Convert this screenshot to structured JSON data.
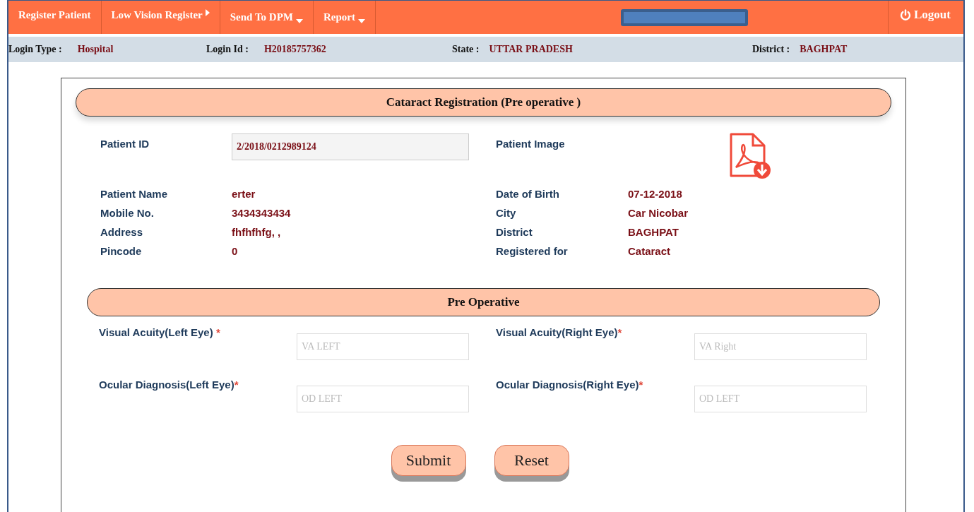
{
  "menu": [
    {
      "label": "Register Patient",
      "kind": "plain"
    },
    {
      "label": "Low Vision Register",
      "kind": "submenu"
    },
    {
      "label": "Send To DPM",
      "kind": "dropdown"
    },
    {
      "label": "Report",
      "kind": "dropdown"
    }
  ],
  "logout": {
    "label": "Logout"
  },
  "info_bar": [
    {
      "label": "Login Type :",
      "value": "Hospital"
    },
    {
      "label": "Login Id :",
      "value": "H20185757362"
    },
    {
      "label": "State :",
      "value": "UTTAR PRADESH"
    },
    {
      "label": "District :",
      "value": "BAGHPAT"
    }
  ],
  "title": "Cataract Registration (Pre operative )",
  "patient_id": {
    "label": "Patient ID",
    "value": "2/2018/0212989124"
  },
  "patient_image": {
    "label": "Patient Image"
  },
  "details_left": [
    {
      "label": "Patient Name",
      "value": "erter"
    },
    {
      "label": "Mobile No.",
      "value": "3434343434"
    },
    {
      "label": "Address",
      "value": "fhfhfhfg, ,"
    },
    {
      "label": "Pincode",
      "value": "0"
    }
  ],
  "details_right": [
    {
      "label": "Date of Birth",
      "value": "07-12-2018"
    },
    {
      "label": "City",
      "value": "Car Nicobar"
    },
    {
      "label": "District",
      "value": "BAGHPAT"
    },
    {
      "label": "Registered for",
      "value": "Cataract"
    }
  ],
  "section_title": "Pre Operative",
  "fields": [
    {
      "label": "Visual Acuity(Left Eye) ",
      "mark": "*",
      "placeholder": "VA LEFT"
    },
    {
      "label": "Visual Acuity(Right Eye)",
      "mark": "*",
      "placeholder": "VA Right"
    },
    {
      "label": "Ocular Diagnosis(Left Eye)",
      "mark": "*",
      "placeholder": "OD LEFT"
    },
    {
      "label": "Ocular Diagnosis(Right Eye)",
      "mark": "*",
      "placeholder": "OD LEFT"
    }
  ],
  "buttons": [
    "Submit",
    "Reset"
  ]
}
